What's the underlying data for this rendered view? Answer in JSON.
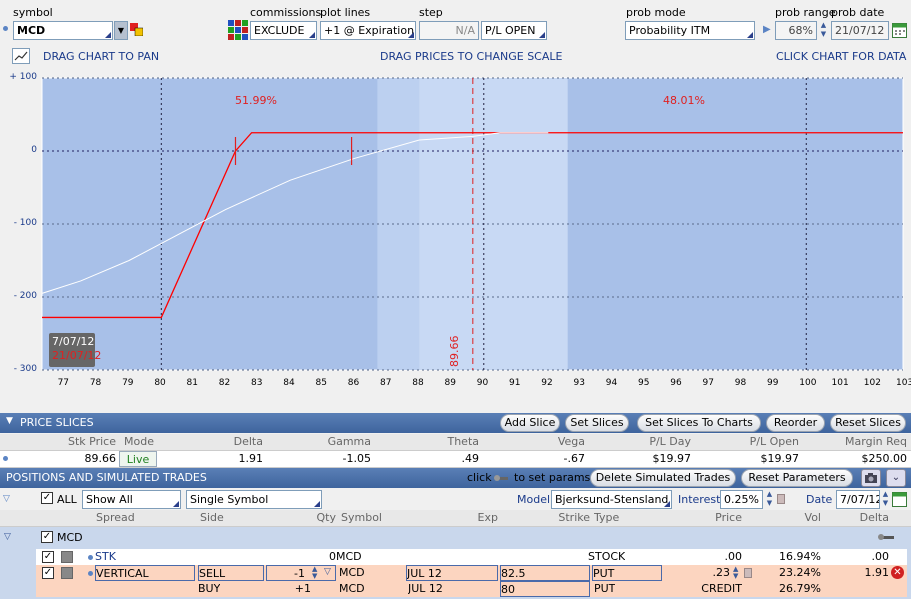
{
  "toolbar": {
    "symbol_label": "symbol",
    "symbol_value": "MCD",
    "commissions_label": "commissions",
    "commissions_value": "EXCLUDE",
    "plot_lines_label": "plot lines",
    "plot_lines_value": "+1 @ Expiration",
    "step_label": "step",
    "step_value": "N/A",
    "pl_value": "P/L OPEN",
    "prob_mode_label": "prob mode",
    "prob_mode_value": "Probability ITM",
    "prob_range_label": "prob range",
    "prob_range_value": "68%",
    "prob_date_label": "prob date",
    "prob_date_value": "21/07/12"
  },
  "chart_hints": {
    "pan": "DRAG CHART TO PAN",
    "scale": "DRAG PRICES TO CHANGE SCALE",
    "data": "CLICK CHART FOR DATA"
  },
  "chart_data": {
    "type": "line",
    "x_ticks": [
      "77",
      "78",
      "79",
      "80",
      "81",
      "82",
      "83",
      "84",
      "85",
      "86",
      "87",
      "88",
      "89",
      "90",
      "91",
      "92",
      "93",
      "94",
      "95",
      "96",
      "97",
      "98",
      "99",
      "100",
      "101",
      "102",
      "103"
    ],
    "y_ticks": [
      "+ 100",
      "0",
      "- 100",
      "- 200",
      "- 300"
    ],
    "ylim": [
      -300,
      100
    ],
    "xlim": [
      76.3,
      103
    ],
    "prob_left": "51.99%",
    "prob_right": "48.01%",
    "current_price_label": "89.66",
    "current_price": 89.66,
    "date_top": "7/07/12",
    "date_bottom": "21/07/12",
    "series": [
      {
        "color": "#ff0000",
        "x": [
          76.3,
          80.0,
          82.3,
          82.8,
          103.0
        ],
        "y": [
          -228,
          -228,
          0,
          25,
          25
        ]
      },
      {
        "color": "#ffffff",
        "x": [
          76.3,
          77.5,
          79.0,
          80.5,
          82.0,
          84.0,
          86.0,
          88.0,
          89.66,
          90.5,
          92.0
        ],
        "y": [
          -195,
          -178,
          -150,
          -115,
          -80,
          -40,
          -10,
          15,
          20,
          25,
          25
        ]
      }
    ],
    "expiration_ticks": [
      82.3,
      85.9
    ],
    "band_outer": [
      86.7,
      92.6
    ],
    "band_inner": [
      88.0,
      92.6
    ]
  },
  "price_slices": {
    "title": "PRICE SLICES",
    "buttons": [
      "Add Slice",
      "Set Slices",
      "Set Slices To Charts",
      "Reorder",
      "Reset Slices"
    ],
    "headers": [
      "Stk Price",
      "Mode",
      "Delta",
      "Gamma",
      "Theta",
      "Vega",
      "P/L Day",
      "P/L Open",
      "Margin Req"
    ],
    "row": [
      "89.66",
      "Live",
      "1.91",
      "-1.05",
      ".49",
      "-.67",
      "$19.97",
      "$19.97",
      "$250.00"
    ]
  },
  "positions": {
    "title": "POSITIONS AND SIMULATED TRADES",
    "click_hint": "click",
    "params_hint": "to set params",
    "delete_btn": "Delete Simulated Trades",
    "reset_btn": "Reset Parameters",
    "all_label": "ALL",
    "show_value": "Show All",
    "symbol_filter": "Single Symbol",
    "model_label": "Model",
    "model_value": "Bjerksund-Stensland",
    "interest_label": "Interest",
    "interest_value": "0.25%",
    "date_label": "Date",
    "date_value": "7/07/12",
    "headers": [
      "Spread",
      "Side",
      "Qty",
      "Symbol",
      "Exp",
      "Strike",
      "Type",
      "Price",
      "Vol",
      "Delta"
    ],
    "group": "MCD",
    "rows": [
      {
        "spread": "STK",
        "side": "",
        "qty": "0",
        "symbol": "MCD",
        "exp": "",
        "strike": "",
        "type": "STOCK",
        "price": ".00",
        "vol": "16.94%",
        "delta": ".00"
      },
      {
        "spread": "VERTICAL",
        "side": "SELL",
        "qty": "-1",
        "symbol": "MCD",
        "exp": "JUL 12",
        "strike": "82.5",
        "type": "PUT",
        "price": ".23",
        "vol": "23.24%",
        "delta": "1.91"
      },
      {
        "spread": "",
        "side": "BUY",
        "qty": "+1",
        "symbol": "MCD",
        "exp": "JUL 12",
        "strike": "80",
        "type": "PUT",
        "price": "CREDIT",
        "vol": "26.79%",
        "delta": ""
      }
    ]
  }
}
